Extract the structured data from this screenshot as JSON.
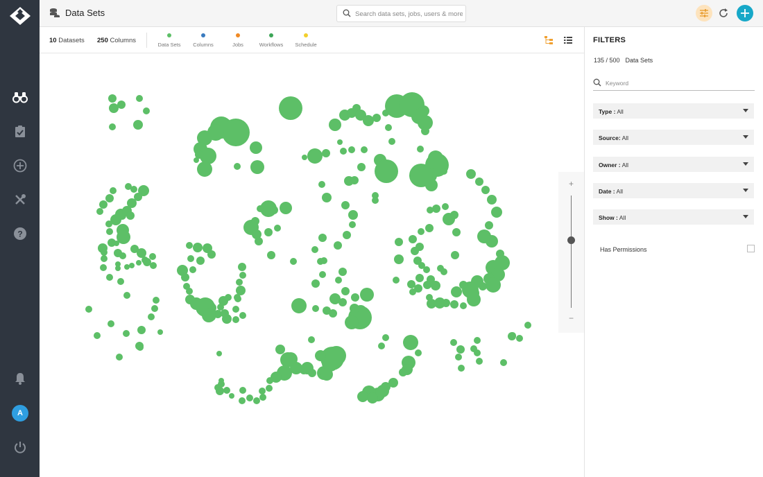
{
  "colors": {
    "sidebar_bg": "#2f3640",
    "accent_teal": "#17a8c8",
    "accent_orange": "#f0a030",
    "bubble_green": "#5dbf67",
    "avatar_blue": "#2f9ee0"
  },
  "sidebar": {
    "logo_icon": "diamond-logo-icon",
    "items": [
      {
        "name": "explore",
        "icon": "binoculars-icon"
      },
      {
        "name": "tasks",
        "icon": "clipboard-check-icon"
      },
      {
        "name": "create",
        "icon": "plus-circle-icon"
      },
      {
        "name": "tools",
        "icon": "tools-icon"
      },
      {
        "name": "help",
        "icon": "help-circle-icon"
      }
    ],
    "notifications_icon": "bell-icon",
    "avatar_initial": "A",
    "power_icon": "power-icon"
  },
  "header": {
    "title": "Data Sets",
    "search_placeholder": "Search data sets, jobs, users & more",
    "filter_icon": "sliders-icon",
    "refresh_icon": "refresh-icon",
    "add_icon": "plus-icon"
  },
  "stats": {
    "datasets_count": "10",
    "datasets_label": "Datasets",
    "columns_count": "250",
    "columns_label": "Columns"
  },
  "legend": [
    {
      "label": "Data Sets",
      "color": "#5dbf67"
    },
    {
      "label": "Columns",
      "color": "#3a7bbf"
    },
    {
      "label": "Jobs",
      "color": "#f08a24"
    },
    {
      "label": "Workflows",
      "color": "#3da557"
    },
    {
      "label": "Schedule",
      "color": "#f2cf2c"
    }
  ],
  "view_toggle": {
    "tree_icon": "tree-view-icon",
    "list_icon": "list-view-icon"
  },
  "zoom": {
    "plus": "+",
    "minus": "−",
    "level": 0.6
  },
  "filters": {
    "title": "FILTERS",
    "count": "135 / 500",
    "count_label": "Data Sets",
    "keyword_placeholder": "Keyword",
    "selects": [
      {
        "label": "Type :",
        "value": "All"
      },
      {
        "label": "Source:",
        "value": "All"
      },
      {
        "label": "Owner :",
        "value": "All"
      },
      {
        "label": "Date :",
        "value": "All"
      },
      {
        "label": "Show :",
        "value": "All"
      }
    ],
    "permissions_label": "Has Permissions",
    "permissions_checked": false
  }
}
